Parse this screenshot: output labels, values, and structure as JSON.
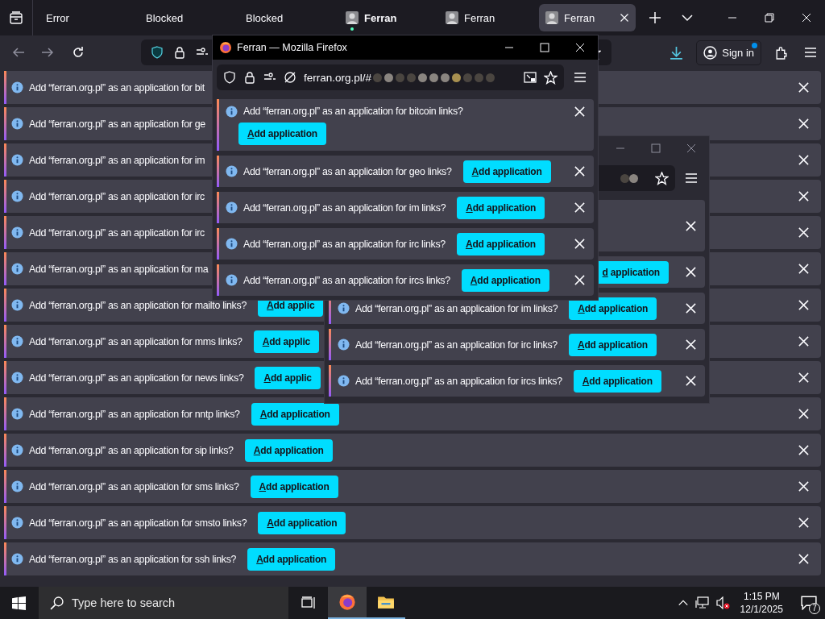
{
  "tabs": [
    {
      "label": "Error",
      "kind": "plain",
      "selected": false,
      "attention": false
    },
    {
      "label": "Blocked",
      "kind": "plain",
      "selected": false,
      "attention": false
    },
    {
      "label": "Blocked",
      "kind": "plain",
      "selected": false,
      "attention": false
    },
    {
      "label": "Ferran",
      "kind": "avatar",
      "selected": false,
      "attention": true
    },
    {
      "label": "Ferran",
      "kind": "avatar",
      "selected": false,
      "attention": false
    },
    {
      "label": "Ferran",
      "kind": "avatar",
      "selected": true,
      "attention": false
    }
  ],
  "toolbar": {
    "sign_in": "Sign in",
    "sign_in_badge": true
  },
  "notifications": [
    {
      "text": "Add “ferran.org.pl” as an application for bit"
    },
    {
      "text": "Add “ferran.org.pl” as an application for ge"
    },
    {
      "text": "Add “ferran.org.pl” as an application for im"
    },
    {
      "text": "Add “ferran.org.pl” as an application for irc"
    },
    {
      "text": "Add “ferran.org.pl” as an application for irc"
    },
    {
      "text": "Add “ferran.org.pl” as an application for ma"
    },
    {
      "text": "Add “ferran.org.pl” as an application for mailto links?",
      "button": "Add applic"
    },
    {
      "text": "Add “ferran.org.pl” as an application for mms links?",
      "button": "Add applic"
    },
    {
      "text": "Add “ferran.org.pl” as an application for news links?",
      "button": "Add applic"
    },
    {
      "text": "Add “ferran.org.pl” as an application for nntp links?",
      "button": "Add application"
    },
    {
      "text": "Add “ferran.org.pl” as an application for sip links?",
      "button": "Add application"
    },
    {
      "text": "Add “ferran.org.pl” as an application for sms links?",
      "button": "Add application"
    },
    {
      "text": "Add “ferran.org.pl” as an application for smsto links?",
      "button": "Add application"
    },
    {
      "text": "Add “ferran.org.pl” as an application for ssh links?",
      "button": "Add application"
    }
  ],
  "popup_back": {
    "rows": [
      {
        "kind": "tall"
      },
      {
        "kind": "inline",
        "button": "d application"
      },
      {
        "kind": "inline",
        "text": "Add “ferran.org.pl” as an application for im links?",
        "button": "Add application"
      },
      {
        "kind": "inline",
        "text": "Add “ferran.org.pl” as an application for irc links?",
        "button": "Add application"
      },
      {
        "kind": "inline",
        "text": "Add “ferran.org.pl” as an application for ircs links?",
        "button": "Add application"
      }
    ]
  },
  "popup_front": {
    "title": "Ferran — Mozilla Firefox",
    "url": "ferran.org.pl/#",
    "rows": [
      {
        "kind": "tall",
        "text": "Add “ferran.org.pl” as an application for bitcoin links?",
        "button": "Add application"
      },
      {
        "kind": "inline",
        "text": "Add “ferran.org.pl” as an application for geo links?",
        "button": "Add application"
      },
      {
        "kind": "inline",
        "text": "Add “ferran.org.pl” as an application for im links?",
        "button": "Add application"
      },
      {
        "kind": "inline",
        "text": "Add “ferran.org.pl” as an application for irc links?",
        "button": "Add application"
      },
      {
        "kind": "inline",
        "text": "Add “ferran.org.pl” as an application for ircs links?",
        "button": "Add application"
      }
    ]
  },
  "taskbar": {
    "search_placeholder": "Type here to search",
    "time": "1:15 PM",
    "date": "12/1/2025",
    "notification_count": "7"
  }
}
